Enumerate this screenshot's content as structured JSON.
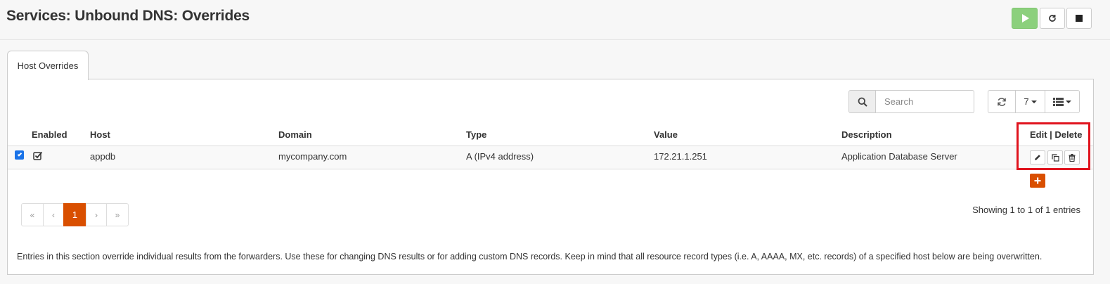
{
  "header": {
    "title": "Services: Unbound DNS: Overrides"
  },
  "tabs": [
    {
      "label": "Host Overrides",
      "active": true
    }
  ],
  "toolbar": {
    "search_placeholder": "Search",
    "page_size": "7"
  },
  "table": {
    "columns": [
      "Enabled",
      "Host",
      "Domain",
      "Type",
      "Value",
      "Description",
      "Edit | Delete"
    ],
    "rows": [
      {
        "selected": true,
        "enabled": true,
        "host": "appdb",
        "domain": "mycompany.com",
        "type": "A (IPv4 address)",
        "value": "172.21.1.251",
        "description": "Application Database Server"
      }
    ]
  },
  "pagination": {
    "first": "«",
    "prev": "‹",
    "current": "1",
    "next": "›",
    "last": "»",
    "summary": "Showing 1 to 1 of 1 entries"
  },
  "note": "Entries in this section override individual results from the forwarders. Use these for changing DNS results or for adding custom DNS records. Keep in mind that all resource record types (i.e. A, AAAA, MX, etc. records) of a specified host below are being overwritten.",
  "colors": {
    "accent": "#d94f00",
    "play": "#8cd07d",
    "highlight": "#e0141e",
    "checkbox": "#1a73e8"
  }
}
